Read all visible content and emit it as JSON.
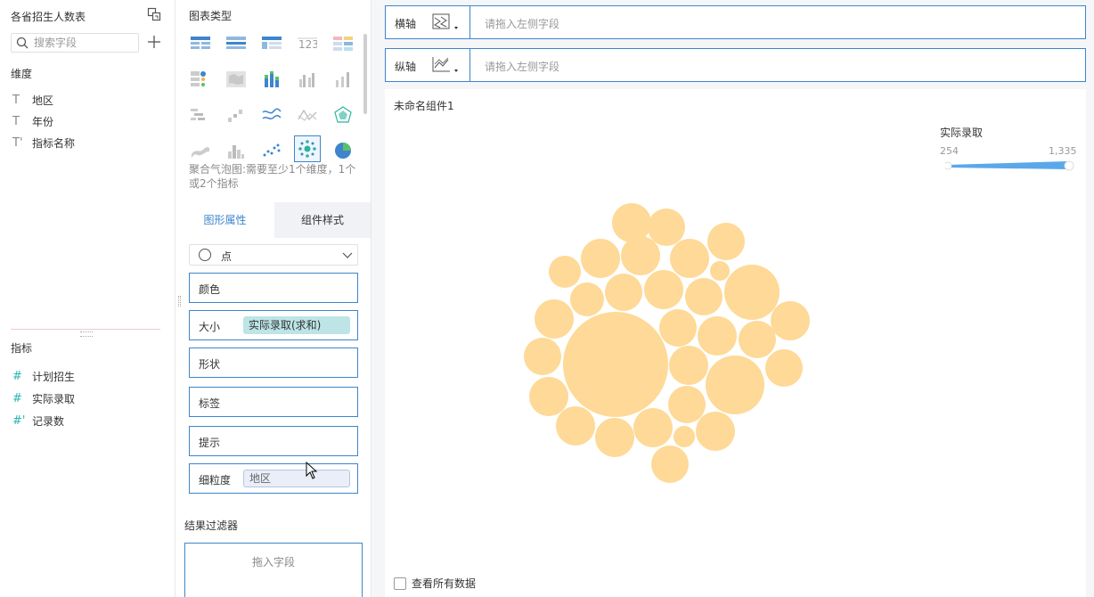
{
  "left_panel": {
    "title": "各省招生人数表",
    "search_placeholder": "搜索字段",
    "dimensions_label": "维度",
    "dimensions": [
      {
        "name": "地区",
        "icon": "T"
      },
      {
        "name": "年份",
        "icon": "T"
      },
      {
        "name": "指标名称",
        "icon": "T'"
      }
    ],
    "metrics_label": "指标",
    "metrics": [
      {
        "name": "计划招生",
        "icon": "#"
      },
      {
        "name": "实际录取",
        "icon": "#"
      },
      {
        "name": "记录数",
        "icon": "#'"
      }
    ]
  },
  "middle_panel": {
    "chart_type_title": "图表类型",
    "chart_type_desc": "聚合气泡图:需要至少1个维度，1个或2个指标",
    "selected_chart_type": "aggregated-bubble",
    "tabs": [
      "图形属性",
      "组件样式"
    ],
    "active_tab": "图形属性",
    "shape_select": "点",
    "properties": {
      "color": "颜色",
      "size": "大小",
      "size_field": "实际录取(求和)",
      "shape": "形状",
      "label": "标签",
      "tooltip": "提示",
      "granularity": "细粒度",
      "granularity_field": "地区"
    },
    "filter_title": "结果过滤器",
    "filter_placeholder": "拖入字段"
  },
  "axes": {
    "x_label": "横轴",
    "y_label": "纵轴",
    "x_placeholder": "请拖入左侧字段",
    "y_placeholder": "请拖入左侧字段"
  },
  "canvas": {
    "component_title": "未命名组件1",
    "legend_title": "实际录取",
    "legend_min": "254",
    "legend_max": "1,335",
    "show_all_label": "查看所有数据",
    "show_all_checked": false
  },
  "colors": {
    "accent": "#3e85cc",
    "bubble": "#fed997",
    "metric_pill": "#bde4e6",
    "legend_bar": "#5aa8ea"
  },
  "chart_data": {
    "type": "bubble",
    "value_range": [
      254,
      1335
    ],
    "bubble_count": 34
  }
}
